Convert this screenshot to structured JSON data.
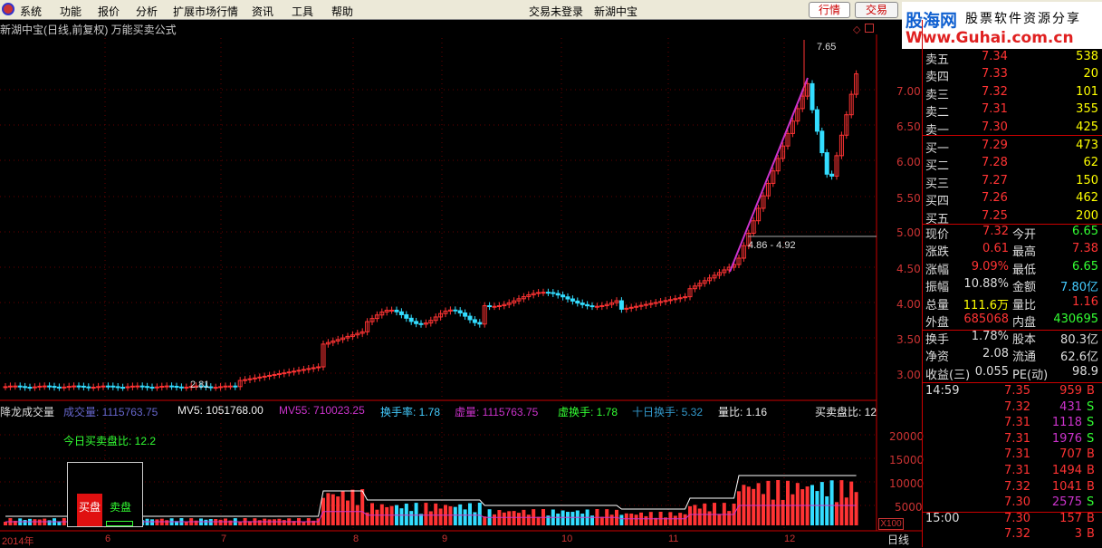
{
  "menu": {
    "items": [
      "系统",
      "功能",
      "报价",
      "分析",
      "扩展市场行情",
      "资讯",
      "工具",
      "帮助"
    ],
    "center_status": "交易未登录",
    "stock_name": "新湖中宝",
    "btn_quote": "行情",
    "btn_trade": "交易"
  },
  "brand": {
    "name": "股海网",
    "slogan": "股票软件资源分享",
    "url": "Www.Guhai.com.cn"
  },
  "chart": {
    "title": "新湖中宝(日线,前复权) 万能买卖公式",
    "high_label": "7.65",
    "low_label": "2.81",
    "range_label": "4.86 - 4.92",
    "y_ticks": [
      "7.00",
      "6.50",
      "6.00",
      "5.50",
      "5.00",
      "4.50",
      "4.00",
      "3.50",
      "3.00"
    ],
    "x_ticks": [
      "2014年",
      "6",
      "7",
      "8",
      "9",
      "10",
      "11",
      "12"
    ],
    "period_button": "日线",
    "vol_scale_label": "X100"
  },
  "volume_header": {
    "name": "降龙成交量",
    "vol": "成交量: 1115763.75",
    "mv5": "MV5: 1051768.00",
    "mv55": "MV55: 710023.25",
    "turnover": "换手率: 1.78",
    "virtual_vol": "虚量: 1115763.75",
    "virtual_turn": "虚换手: 1.78",
    "ten_day_turn": "十日换手: 5.32",
    "vol_ratio": "量比: 1.16",
    "buy_sell_ratio": "买卖盘比: 12",
    "today_ratio": "今日买卖盘比: 12.2",
    "buy_label": "买盘",
    "sell_label": "卖盘",
    "y_ticks": [
      "20000",
      "15000",
      "10000",
      "5000"
    ]
  },
  "order_book": {
    "asks": [
      {
        "label": "卖五",
        "price": "7.34",
        "vol": "538"
      },
      {
        "label": "卖四",
        "price": "7.33",
        "vol": "20"
      },
      {
        "label": "卖三",
        "price": "7.32",
        "vol": "101"
      },
      {
        "label": "卖二",
        "price": "7.31",
        "vol": "355"
      },
      {
        "label": "卖一",
        "price": "7.30",
        "vol": "425"
      }
    ],
    "bids": [
      {
        "label": "买一",
        "price": "7.29",
        "vol": "473"
      },
      {
        "label": "买二",
        "price": "7.28",
        "vol": "62"
      },
      {
        "label": "买三",
        "price": "7.27",
        "vol": "150"
      },
      {
        "label": "买四",
        "price": "7.26",
        "vol": "462"
      },
      {
        "label": "买五",
        "price": "7.25",
        "vol": "200"
      }
    ]
  },
  "quote": {
    "now_l": "现价",
    "now": "7.32",
    "open_l": "今开",
    "open": "6.65",
    "chg_l": "涨跌",
    "chg": "0.61",
    "high_l": "最高",
    "high": "7.38",
    "pct_l": "涨幅",
    "pct": "9.09%",
    "low_l": "最低",
    "low": "6.65",
    "amp_l": "振幅",
    "amp": "10.88%",
    "amt_l": "金额",
    "amt": "7.80亿",
    "tvol_l": "总量",
    "tvol": "111.6万",
    "vr_l": "量比",
    "vr": "1.16",
    "outer_l": "外盘",
    "outer": "685068",
    "inner_l": "内盘",
    "inner": "430695",
    "turn_l": "换手",
    "turn": "1.78%",
    "cap_l": "股本",
    "cap": "80.3亿",
    "nav_l": "净资",
    "nav": "2.08",
    "float_l": "流通",
    "float": "62.6亿",
    "eps_l": "收益(三)",
    "eps": "0.055",
    "pe_l": "PE(动)",
    "pe": "98.9"
  },
  "ticks": [
    {
      "time": "14:59",
      "price": "7.35",
      "vol": "959",
      "side": "B",
      "color": "#ff4444"
    },
    {
      "time": "",
      "price": "7.32",
      "vol": "431",
      "side": "S",
      "color": "#ff4444"
    },
    {
      "time": "",
      "price": "7.31",
      "vol": "1118",
      "side": "S",
      "color": "#ff4444"
    },
    {
      "time": "",
      "price": "7.31",
      "vol": "1976",
      "side": "S",
      "color": "#ff4444"
    },
    {
      "time": "",
      "price": "7.31",
      "vol": "707",
      "side": "B",
      "color": "#ff4444"
    },
    {
      "time": "",
      "price": "7.31",
      "vol": "1494",
      "side": "B",
      "color": "#ff4444"
    },
    {
      "time": "",
      "price": "7.32",
      "vol": "1041",
      "side": "B",
      "color": "#ff4444"
    },
    {
      "time": "",
      "price": "7.30",
      "vol": "2575",
      "side": "S",
      "color": "#ff4444"
    },
    {
      "time": "15:00",
      "price": "7.30",
      "vol": "157",
      "side": "B",
      "color": "#ff4444"
    },
    {
      "time": "",
      "price": "7.32",
      "vol": "3",
      "side": "B",
      "color": "#ff4444"
    }
  ]
}
